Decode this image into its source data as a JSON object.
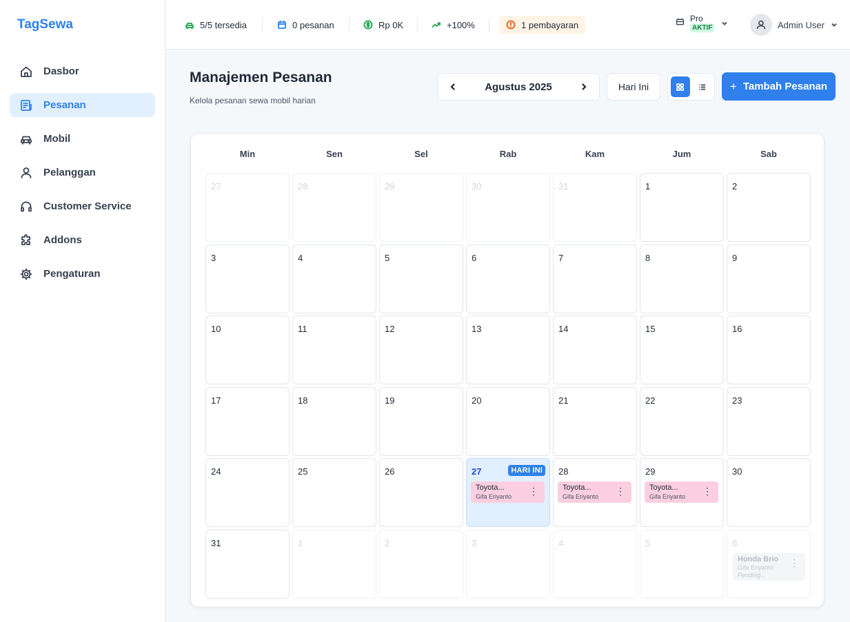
{
  "brand": "TagSewa",
  "sidebar": {
    "items": [
      {
        "label": "Dasbor",
        "icon": "home-icon"
      },
      {
        "label": "Pesanan",
        "icon": "receipt-icon",
        "active": true
      },
      {
        "label": "Mobil",
        "icon": "car-icon"
      },
      {
        "label": "Pelanggan",
        "icon": "user-icon"
      },
      {
        "label": "Customer Service",
        "icon": "headset-icon"
      },
      {
        "label": "Addons",
        "icon": "puzzle-icon"
      },
      {
        "label": "Pengaturan",
        "icon": "gear-icon"
      }
    ]
  },
  "topbar": {
    "stats": [
      {
        "label": "5/5 tersedia",
        "icon": "car-icon",
        "color": "#16a34a"
      },
      {
        "label": "0 pesanan",
        "icon": "calendar-icon",
        "color": "#2f80ed"
      },
      {
        "label": "Rp 0K",
        "icon": "dollar-icon",
        "color": "#16a34a"
      },
      {
        "label": "+100%",
        "icon": "trend-up-icon",
        "color": "#16a34a"
      },
      {
        "label": "1 pembayaran",
        "icon": "alert-icon",
        "color": "#ea580c"
      }
    ],
    "plan": {
      "name": "Pro",
      "status": "AKTIF"
    },
    "user": {
      "name": "Admin User"
    }
  },
  "header": {
    "title": "Manajemen Pesanan",
    "subtitle": "Kelola pesanan sewa mobil harian",
    "month": "Agustus 2025",
    "today_button": "Hari Ini",
    "add_button": "Tambah Pesanan"
  },
  "calendar": {
    "weekdays": [
      "Min",
      "Sen",
      "Sel",
      "Rab",
      "Kam",
      "Jum",
      "Sab"
    ],
    "today_label": "HARI INI",
    "weeks": [
      [
        {
          "d": "27",
          "o": true
        },
        {
          "d": "28",
          "o": true
        },
        {
          "d": "29",
          "o": true
        },
        {
          "d": "30",
          "o": true
        },
        {
          "d": "31",
          "o": true
        },
        {
          "d": "1"
        },
        {
          "d": "2"
        }
      ],
      [
        {
          "d": "3"
        },
        {
          "d": "4"
        },
        {
          "d": "5"
        },
        {
          "d": "6"
        },
        {
          "d": "7"
        },
        {
          "d": "8"
        },
        {
          "d": "9"
        }
      ],
      [
        {
          "d": "10"
        },
        {
          "d": "11"
        },
        {
          "d": "12"
        },
        {
          "d": "13"
        },
        {
          "d": "14"
        },
        {
          "d": "15"
        },
        {
          "d": "16"
        }
      ],
      [
        {
          "d": "17"
        },
        {
          "d": "18"
        },
        {
          "d": "19"
        },
        {
          "d": "20"
        },
        {
          "d": "21"
        },
        {
          "d": "22"
        },
        {
          "d": "23"
        }
      ],
      [
        {
          "d": "24"
        },
        {
          "d": "25"
        },
        {
          "d": "26"
        },
        {
          "d": "27",
          "today": true,
          "events": [
            {
              "car": "Toyota...",
              "customer": "Gifa Eriyanto"
            }
          ]
        },
        {
          "d": "28",
          "events": [
            {
              "car": "Toyota...",
              "customer": "Gifa Eriyanto"
            }
          ]
        },
        {
          "d": "29",
          "events": [
            {
              "car": "Toyota...",
              "customer": "Gifa Eriyanto"
            }
          ]
        },
        {
          "d": "30"
        }
      ],
      [
        {
          "d": "31"
        },
        {
          "d": "1",
          "o": true
        },
        {
          "d": "2",
          "o": true
        },
        {
          "d": "3",
          "o": true
        },
        {
          "d": "4",
          "o": true
        },
        {
          "d": "5",
          "o": true
        },
        {
          "d": "6",
          "o": true,
          "events": [
            {
              "car": "Honda Brio",
              "customer": "Gifa Eriyanto",
              "status": "Pending...",
              "faded": true
            }
          ]
        }
      ]
    ]
  }
}
